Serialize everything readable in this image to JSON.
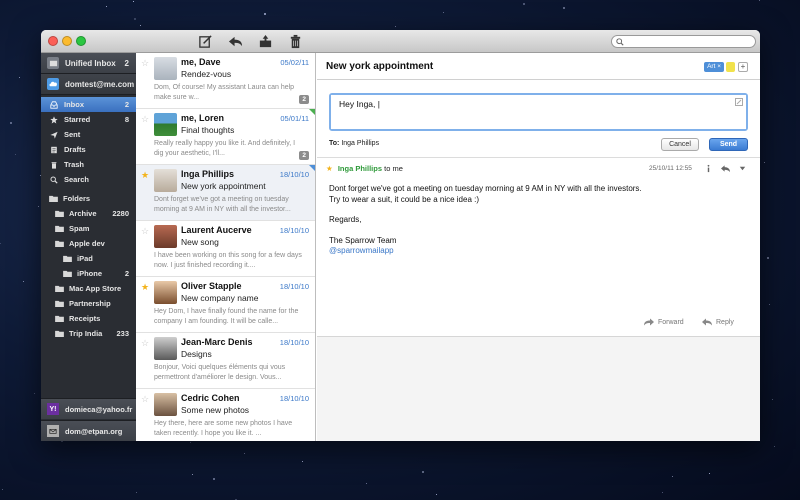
{
  "toolbar": {
    "compose_icon": "compose-icon",
    "reply_icon": "reply-icon",
    "archive_icon": "archive-icon",
    "trash_icon": "trash-icon",
    "search_placeholder": ""
  },
  "sidebar": {
    "unified": {
      "label": "Unified Inbox",
      "count": "2"
    },
    "account": {
      "label": "domtest@me.com"
    },
    "nav": [
      {
        "label": "Inbox",
        "count": "2",
        "icon": "inbox-icon"
      },
      {
        "label": "Starred",
        "count": "8",
        "icon": "star-icon"
      },
      {
        "label": "Sent",
        "count": "",
        "icon": "sent-icon"
      },
      {
        "label": "Drafts",
        "count": "",
        "icon": "drafts-icon"
      },
      {
        "label": "Trash",
        "count": "",
        "icon": "trash-icon"
      },
      {
        "label": "Search",
        "count": "",
        "icon": "search-icon"
      }
    ],
    "folders_label": "Folders",
    "folders": [
      {
        "label": "Archive",
        "count": "2280",
        "level": 1
      },
      {
        "label": "Spam",
        "count": "",
        "level": 1
      },
      {
        "label": "Apple dev",
        "count": "",
        "level": 1
      },
      {
        "label": "iPad",
        "count": "",
        "level": 2
      },
      {
        "label": "iPhone",
        "count": "2",
        "level": 2
      },
      {
        "label": "Mac App Store",
        "count": "",
        "level": 1
      },
      {
        "label": "Partnership",
        "count": "",
        "level": 1
      },
      {
        "label": "Receipts",
        "count": "",
        "level": 1
      },
      {
        "label": "Trip India",
        "count": "233",
        "level": 1
      }
    ],
    "other_accounts": [
      {
        "label": "domieca@yahoo.fr"
      },
      {
        "label": "dom@etpan.org"
      }
    ]
  },
  "messages": [
    {
      "sender": "me, Dave",
      "date": "05/02/11",
      "subject": "Rendez-vous",
      "preview": "Dom, Of course! My assistant Laura can help make sure w...",
      "thread": "2",
      "starred": false,
      "corner": ""
    },
    {
      "sender": "me, Loren",
      "date": "05/01/11",
      "subject": "Final thoughts",
      "preview": "Really really happy you like it. And definitely, I dig your aesthetic, I'll...",
      "thread": "2",
      "starred": false,
      "corner": "#4caf50"
    },
    {
      "sender": "Inga Phillips",
      "date": "18/10/10",
      "subject": "New york appointment",
      "preview": "Dont forget we've got a meeting on tuesday morning at 9 AM in NY with all the investor...",
      "thread": "",
      "starred": true,
      "corner": "#4e8fd8"
    },
    {
      "sender": "Laurent Aucerve",
      "date": "18/10/10",
      "subject": "New song",
      "preview": "I have been working on this song for a few days now. I just finished recording it....",
      "thread": "",
      "starred": false,
      "corner": ""
    },
    {
      "sender": "Oliver Stapple",
      "date": "18/10/10",
      "subject": "New company name",
      "preview": "Hey Dom, I have finally found the name for the company I am founding. It will be calle...",
      "thread": "",
      "starred": true,
      "corner": ""
    },
    {
      "sender": "Jean-Marc Denis",
      "date": "18/10/10",
      "subject": "Designs",
      "preview": "Bonjour, Voici quelques éléments qui vous permettront d'améliorer le design. Vous...",
      "thread": "",
      "starred": false,
      "corner": ""
    },
    {
      "sender": "Cedric Cohen",
      "date": "18/10/10",
      "subject": "Some new photos",
      "preview": "Hey there, here are some new photos I have taken recently. I hope you like it. ...",
      "thread": "",
      "starred": false,
      "corner": ""
    }
  ],
  "reading": {
    "title": "New york appointment",
    "tag_art": "Art",
    "tag_art_close": "×",
    "tag_plus": "+",
    "reply_text": "Hey Inga, |",
    "to_label": "To:",
    "to_value": "Inga Phillips",
    "cancel": "Cancel",
    "send": "Send",
    "from": "Inga Phillips",
    "to_me": "to me",
    "date": "25/10/11 12:55",
    "body_line1": "Dont forget we've got a meeting on tuesday morning at 9 AM in NY with all the investors.",
    "body_line2": "Try to wear a suit, it could be a nice idea :)",
    "regards": "Regards,",
    "signature": "The Sparrow Team",
    "link": "@sparrowmailapp",
    "forward": "Forward",
    "reply": "Reply"
  },
  "colors": {
    "accent": "#3b78c8",
    "sidebar_bg": "#2a2d33",
    "star": "#f3b31b",
    "from_green": "#2f9a3a"
  }
}
